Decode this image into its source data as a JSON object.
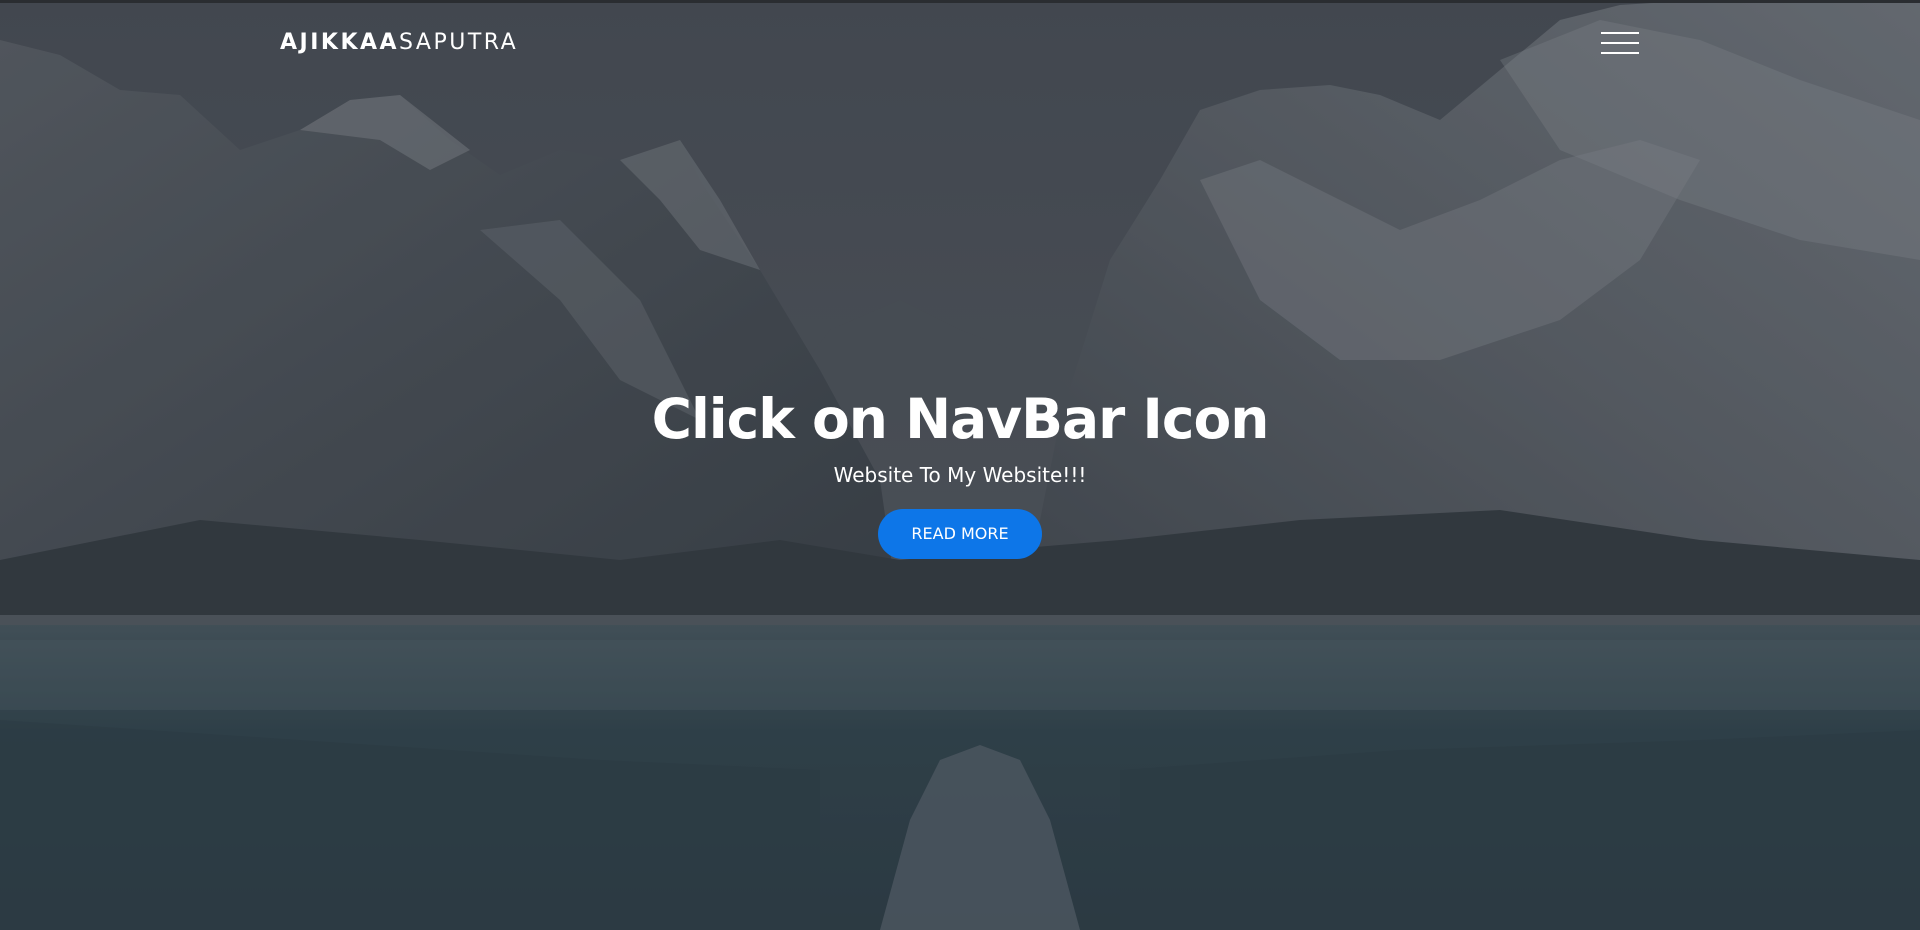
{
  "header": {
    "logo_bold": "AJIKKAA",
    "logo_light": "SAPUTRA",
    "menu_icon": "hamburger-menu-icon"
  },
  "hero": {
    "title": "Click on NavBar Icon",
    "subtitle": "Website To My Website!!!",
    "button_label": "READ MORE",
    "background": "snowy mountain valley above a lake, darkened with a grey overlay"
  },
  "colors": {
    "accent": "#0d76e8",
    "text": "#ffffff",
    "overlay": "#3d4650"
  }
}
